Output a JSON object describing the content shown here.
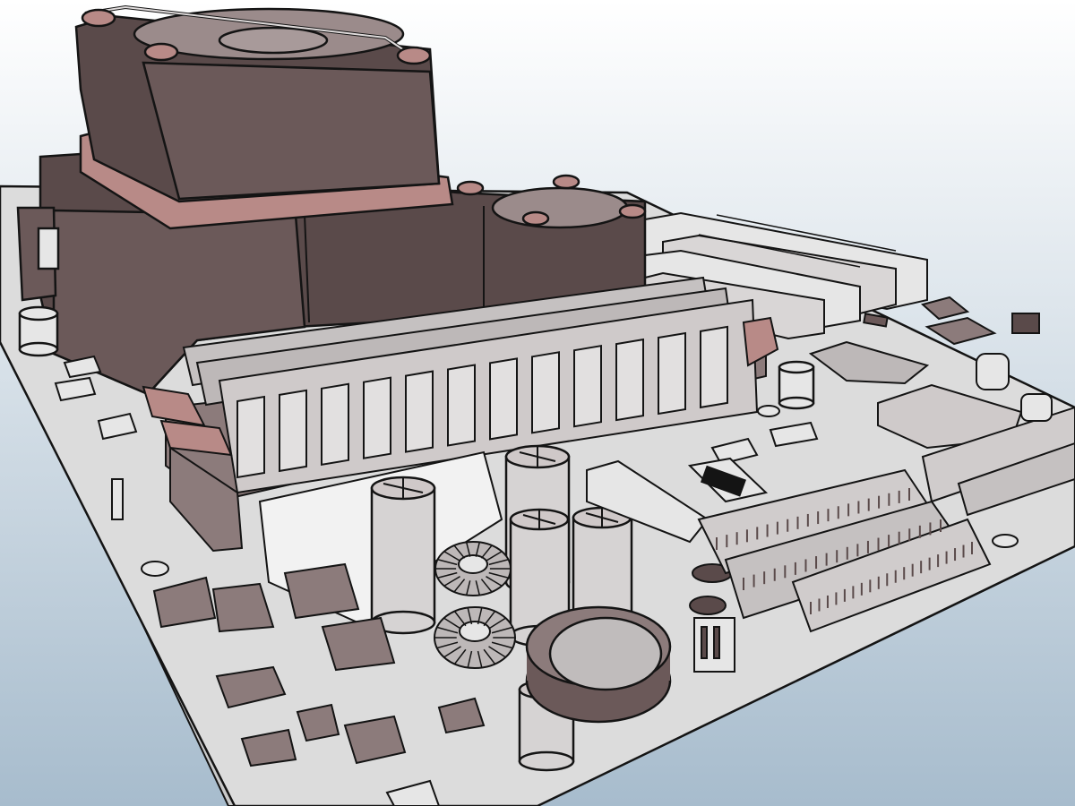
{
  "scene": {
    "subject": "motherboard-3d-render",
    "style": "cel-shaded-sketch",
    "colors": {
      "background_top": "#ffffff",
      "background_bottom": "#a7bccd",
      "board": "#dcdcdc",
      "board_edge": "#c9c9c9",
      "outline": "#141414",
      "cooler": "#5a4a4a",
      "cooler_light": "#6b5959",
      "accent_pink": "#b88a87",
      "component_light": "#e6e6e6",
      "component_mid": "#bdb8b8",
      "component_dark": "#8c7b7b",
      "heatsink_body": "#d6d3d3",
      "capacitor_cap": "#cfc8c8"
    },
    "icons": [
      "cpu-cooler-icon",
      "ram-module-icon",
      "capacitor-icon",
      "pci-slot-icon",
      "chip-icon",
      "fan-icon"
    ]
  }
}
